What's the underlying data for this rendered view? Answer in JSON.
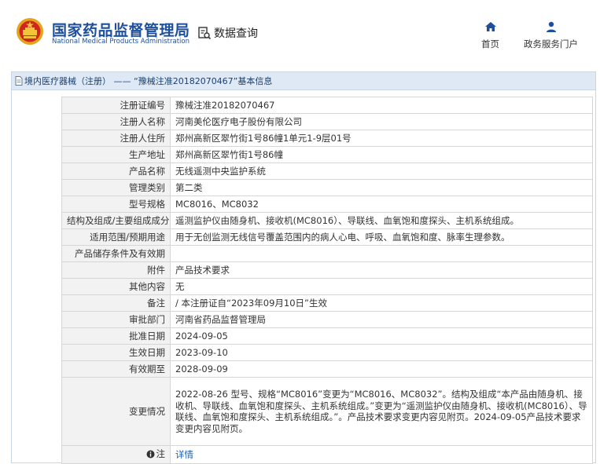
{
  "header": {
    "brand_cn": "国家药品监督管理局",
    "brand_en": "National Medical Products Administration",
    "data_query": "数据查询",
    "nav": {
      "home": "首页",
      "portal": "政务服务门户"
    }
  },
  "breadcrumb": {
    "category": "境内医疗器械（注册）",
    "separator": " —— ",
    "record": "“豫械注准20182070467”基本信息"
  },
  "rows": [
    {
      "label": "注册证编号",
      "value": "豫械注准20182070467"
    },
    {
      "label": "注册人名称",
      "value": "河南美伦医疗电子股份有限公司"
    },
    {
      "label": "注册人住所",
      "value": "郑州高新区翠竹街1号86幢1单元1-9层01号"
    },
    {
      "label": "生产地址",
      "value": "郑州高新区翠竹街1号86幢"
    },
    {
      "label": "产品名称",
      "value": "无线遥测中央监护系统"
    },
    {
      "label": "管理类别",
      "value": "第二类"
    },
    {
      "label": "型号规格",
      "value": "MC8016、MC8032"
    },
    {
      "label": "结构及组成/主要组成成分",
      "value": "遥测监护仪由随身机、接收机(MC8016）、导联线、血氧饱和度探头、主机系统组成。"
    },
    {
      "label": "适用范围/预期用途",
      "value": "用于无创监测无线信号覆盖范围内的病人心电、呼吸、血氧饱和度、脉率生理参数。"
    },
    {
      "label": "产品储存条件及有效期",
      "value": ""
    },
    {
      "label": "附件",
      "value": "产品技术要求"
    },
    {
      "label": "其他内容",
      "value": "无"
    },
    {
      "label": "备注",
      "value": "/ 本注册证自“2023年09月10日”生效"
    },
    {
      "label": "审批部门",
      "value": "河南省药品监督管理局"
    },
    {
      "label": "批准日期",
      "value": "2024-09-05"
    },
    {
      "label": "生效日期",
      "value": "2023-09-10"
    },
    {
      "label": "有效期至",
      "value": "2028-09-09"
    }
  ],
  "change": {
    "label": "变更情况",
    "value": "2022-08-26 型号、规格“MC8016”变更为“MC8016、MC8032”。结构及组成“本产品由随身机、接收机、导联线、血氧饱和度探头、主机系统组成。”变更为“遥测监护仪由随身机、接收机(MC8016）、导联线、血氧饱和度探头、主机系统组成。”。产品技术要求变更内容见附页。2024-09-05产品技术要求变更内容见附页。"
  },
  "note": {
    "label": "注",
    "link": "详情"
  }
}
